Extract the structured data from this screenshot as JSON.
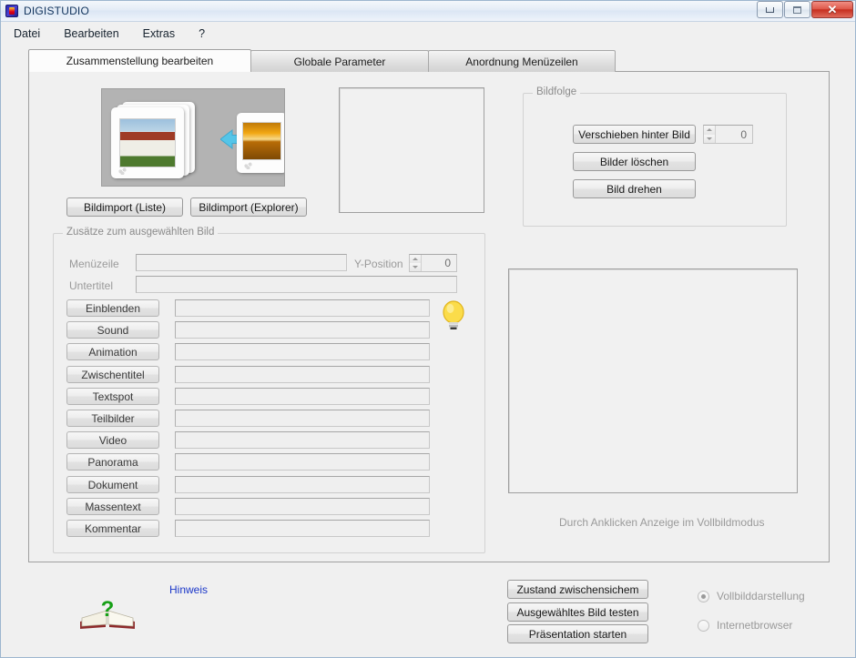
{
  "window": {
    "title": "DIGISTUDIO",
    "icon": "app-icon",
    "controls": {
      "minimize": "minimize-button",
      "maximize": "maximize-button",
      "close": "✕"
    }
  },
  "menubar": {
    "items": [
      "Datei",
      "Bearbeiten",
      "Extras",
      "?"
    ]
  },
  "tabs": [
    {
      "label": "Zusammenstellung bearbeiten",
      "active": true
    },
    {
      "label": "Globale Parameter",
      "active": false
    },
    {
      "label": "Anordnung Menüzeilen",
      "active": false
    }
  ],
  "import": {
    "buttons": [
      "Bildimport (Liste)",
      "Bildimport (Explorer)"
    ]
  },
  "bildfolge": {
    "title": "Bildfolge",
    "buttons": [
      "Verschieben hinter Bild",
      "Bilder löschen",
      "Bild drehen"
    ],
    "spinner_value": "0"
  },
  "zusaetze": {
    "title": "Zusätze zum ausgewählten Bild",
    "menuezeile_label": "Menüzeile",
    "menuezeile_value": "",
    "yposition_label": "Y-Position",
    "yposition_value": "0",
    "untertitel_label": "Untertitel",
    "untertitel_value": "",
    "rows": [
      {
        "label": "Einblenden",
        "value": ""
      },
      {
        "label": "Sound",
        "value": ""
      },
      {
        "label": "Animation",
        "value": ""
      },
      {
        "label": "Zwischentitel",
        "value": ""
      },
      {
        "label": "Textspot",
        "value": ""
      },
      {
        "label": "Teilbilder",
        "value": ""
      },
      {
        "label": "Video",
        "value": ""
      },
      {
        "label": "Panorama",
        "value": ""
      },
      {
        "label": "Dokument",
        "value": ""
      },
      {
        "label": "Massentext",
        "value": ""
      },
      {
        "label": "Kommentar",
        "value": ""
      }
    ]
  },
  "preview": {
    "caption": "Durch Anklicken Anzeige im Vollbildmodus"
  },
  "footer": {
    "hint_link": "Hinweis",
    "buttons": [
      "Zustand zwischensichem",
      "Ausgewähltes Bild testen",
      "Präsentation starten"
    ],
    "radios": [
      {
        "label": "Vollbilddarstellung",
        "selected": true
      },
      {
        "label": "Internetbrowser",
        "selected": false
      }
    ]
  },
  "colors": {
    "accent_link": "#1b37c9",
    "close_button": "#c62f20",
    "bulb": "#f7d038"
  }
}
